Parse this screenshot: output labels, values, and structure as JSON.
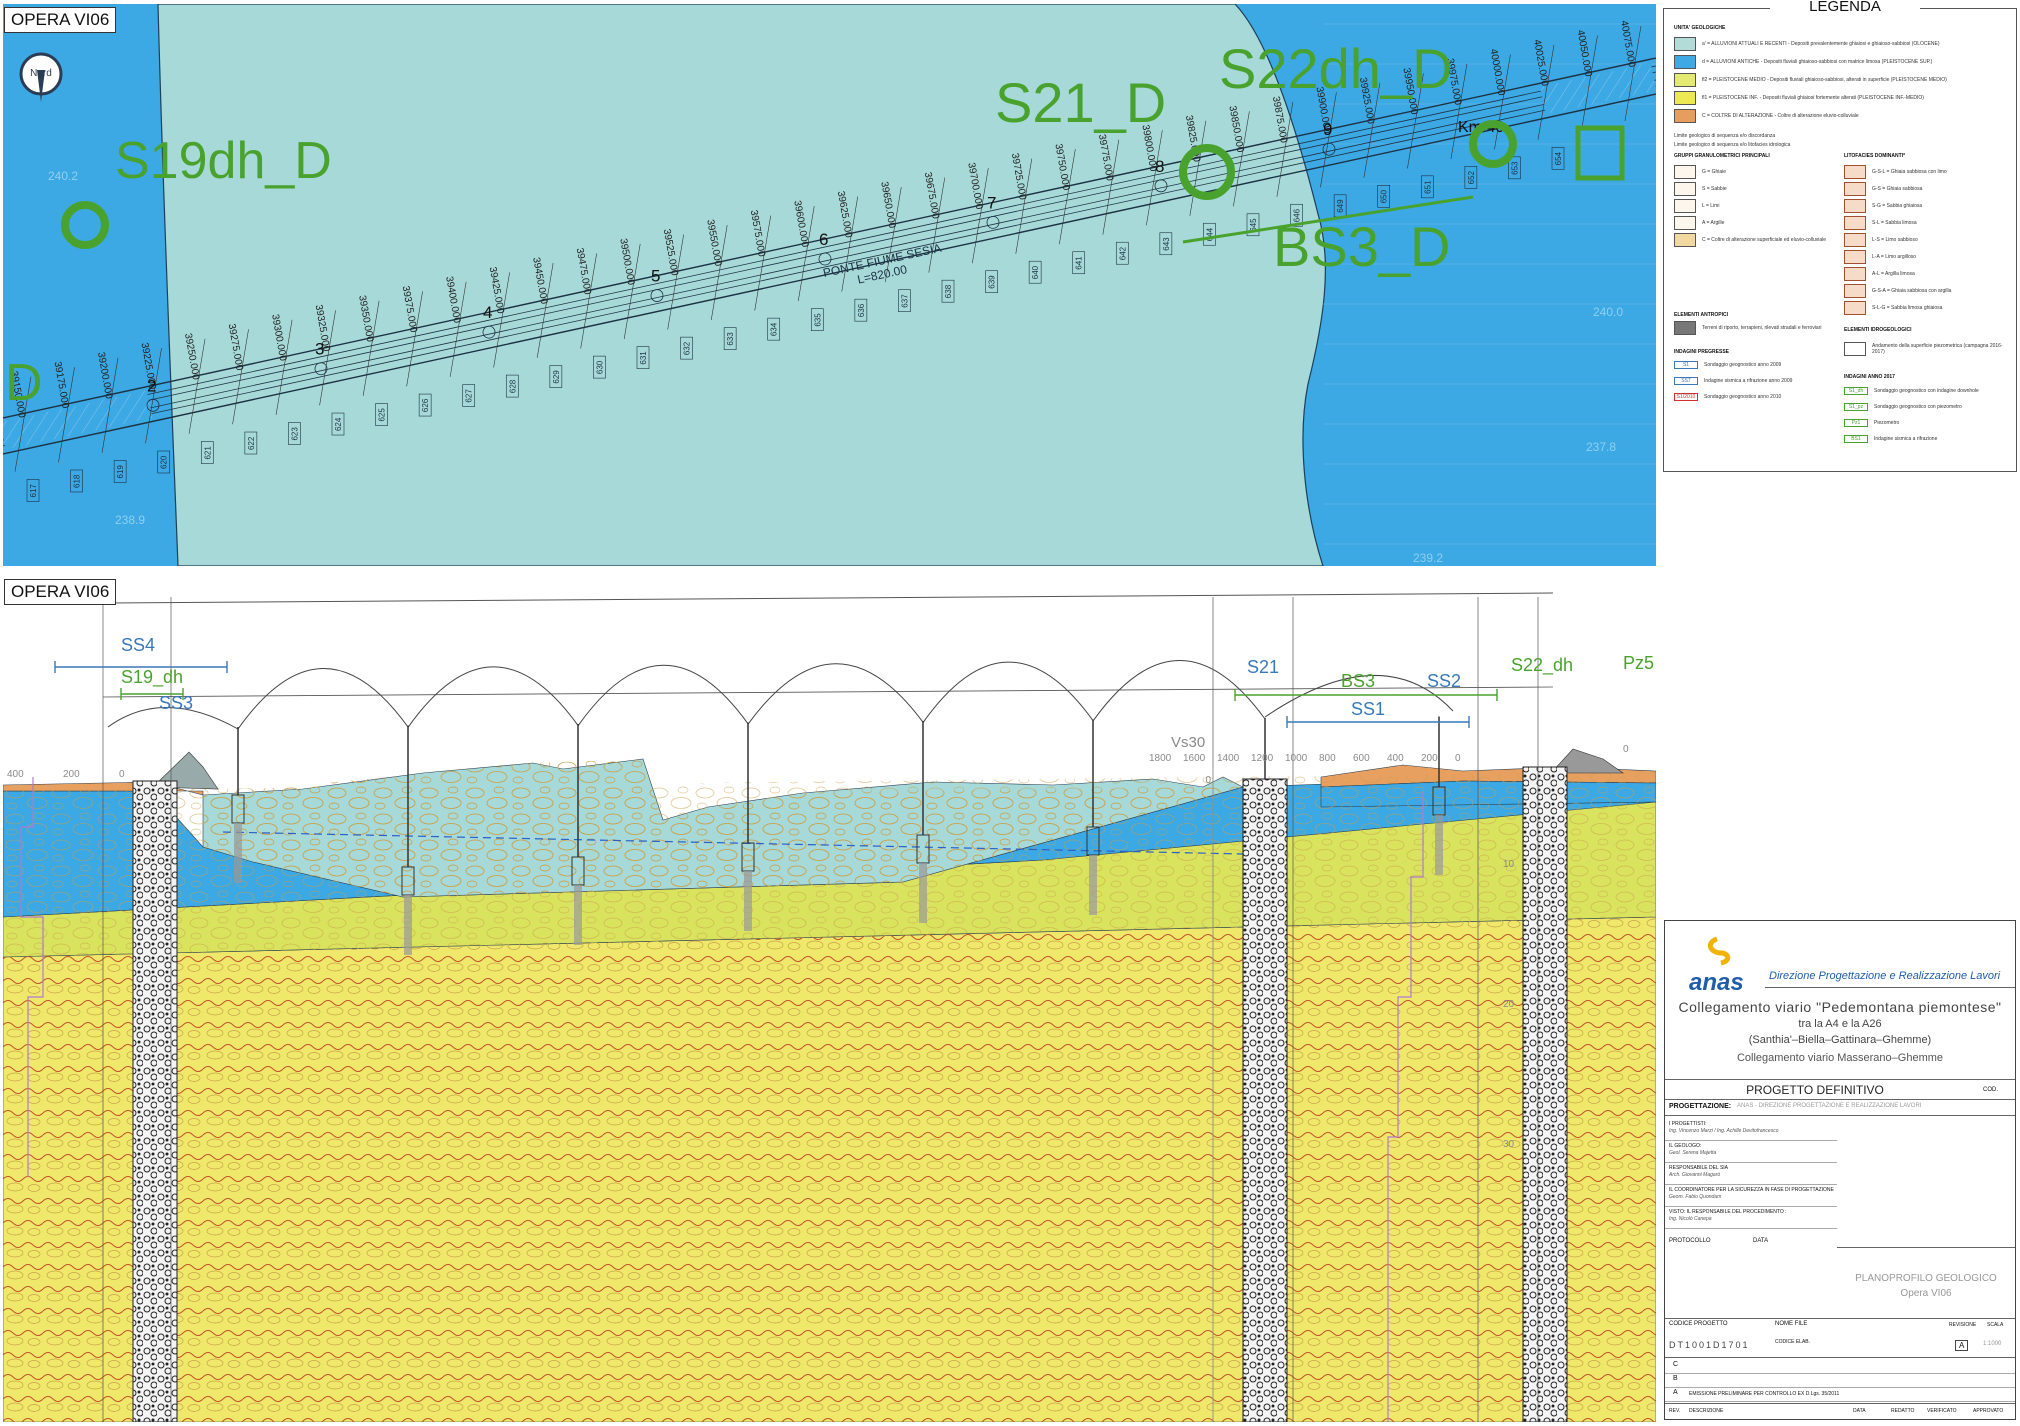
{
  "panels": {
    "plan_label": "OPERA VI06",
    "profile_label": "OPERA VI06"
  },
  "plan": {
    "north_label": "Nord",
    "boreholes": [
      {
        "id": "S19dh_D"
      },
      {
        "id": "S21_D"
      },
      {
        "id": "S22dh_D"
      },
      {
        "id": "BS3_D"
      },
      {
        "id": "D"
      }
    ],
    "bridge_name": "PONTE FIUME SESIA",
    "bridge_length": "L=820.00",
    "km_label": "Km 40",
    "pier_numbers": [
      "2",
      "3",
      "4",
      "5",
      "6",
      "7",
      "8",
      "9"
    ],
    "chainages": [
      "39150.000",
      "39175.000",
      "39200.000",
      "39225.000",
      "39250.000",
      "39275.000",
      "39300.000",
      "39325.000",
      "39350.000",
      "39375.000",
      "39400.000",
      "39425.000",
      "39450.000",
      "39475.000",
      "39500.000",
      "39525.000",
      "39550.000",
      "39575.000",
      "39600.000",
      "39625.000",
      "39650.000",
      "39675.000",
      "39700.000",
      "39725.000",
      "39750.000",
      "39775.000",
      "39800.000",
      "39825.000",
      "39850.000",
      "39875.000",
      "39900.000",
      "39925.000",
      "39950.000",
      "39975.000",
      "40000.000",
      "40025.000",
      "40050.000",
      "40075.000"
    ],
    "sections": [
      "617",
      "618",
      "619",
      "620",
      "621",
      "622",
      "623",
      "624",
      "625",
      "626",
      "627",
      "628",
      "629",
      "630",
      "631",
      "632",
      "633",
      "634",
      "635",
      "636",
      "637",
      "638",
      "639",
      "640",
      "641",
      "642",
      "643",
      "644",
      "645",
      "646",
      "649",
      "650",
      "651",
      "652",
      "653",
      "654"
    ],
    "elevations": [
      "240.2",
      "238.9",
      "240.0",
      "237.8",
      "239.2"
    ]
  },
  "profile": {
    "labels": [
      {
        "text": "SS4",
        "color": "#3a78b8"
      },
      {
        "text": "S19_dh",
        "color": "#4aa22e"
      },
      {
        "text": "SS3",
        "color": "#3a78b8"
      },
      {
        "text": "S21",
        "color": "#3a78b8"
      },
      {
        "text": "BS3",
        "color": "#4aa22e"
      },
      {
        "text": "SS2",
        "color": "#3a78b8"
      },
      {
        "text": "SS1",
        "color": "#3a78b8"
      },
      {
        "text": "S22_dh",
        "color": "#4aa22e"
      },
      {
        "text": "Pz5",
        "color": "#4aa22e"
      }
    ],
    "vs30_label": "Vs30",
    "vs30_ticks": [
      "1800",
      "1600",
      "1400",
      "1200",
      "1000",
      "800",
      "600",
      "400",
      "200",
      "0"
    ],
    "left_ticks": [
      "400",
      "200",
      "0"
    ],
    "right_tick": "0",
    "depth_label": "0",
    "aside_numbers": [
      "10",
      "20",
      "30"
    ]
  },
  "legend": {
    "title": "LEGENDA",
    "sections": {
      "units": "UNITA' GEOLOGICHE",
      "groups": "GRUPPI GRANULOMETRICI PRINCIPALI",
      "lithofacies": "LITOFACIES DOMINANTI*",
      "anthropic": "ELEMENTI ANTROPICI",
      "prior": "INDAGINI PREGRESSE",
      "hydro": "ELEMENTI IDROGEOLOGICI",
      "survey2017": "INDAGINI ANNO 2017"
    },
    "unit_rows": [
      {
        "color": "#b3dcd8",
        "text": "a' = ALLUVIONI ATTUALI E RECENTI - Depositi prevalentemente ghiaiosi e ghiaioso-sabbiosi (OLOCENE)"
      },
      {
        "color": "#3fa9e6",
        "text": "d = ALLUVIONI ANTICHE - Depositi fluviali ghiaioso-sabbiosi con matrice limosa (PLEISTOCENE SUP.)"
      },
      {
        "color": "#e3ea6f",
        "text": "fl2 = PLEISTOCENE MEDIO - Depositi fluviali ghiaioso-sabbiosi, alterati in superficie (PLEISTOCENE MEDIO)"
      },
      {
        "color": "#ece955",
        "text": "fl1 = PLEISTOCENE INF. - Depositi fluviali ghiaiosi fortemente alterati (PLEISTOCENE INF.-MEDIO)"
      },
      {
        "color": "#e79d5d",
        "text": "C = COLTRE DI ALTERAZIONE - Coltre di alterazione eluvio-colluviale"
      }
    ],
    "line_rows": [
      {
        "text": "Limite geologico di sequenza e/o discordanza"
      },
      {
        "text": "Limite geologico di sequenza e/o litofacies idrologica"
      }
    ],
    "group_rows": [
      "G = Ghiaie",
      "S = Sabbie",
      "L = Limi",
      "A = Argille",
      "C = Coltre di alterazione superficiale ed eluvio-colluviale"
    ],
    "litho_rows": [
      "G-S-L = Ghiaia sabbiosa con limo",
      "G-S = Ghiaia sabbiosa",
      "S-G = Sabbia ghiaiosa",
      "S-L = Sabbia limosa",
      "L-S = Limo sabbioso",
      "L-A = Limo argilloso",
      "A-L = Argilla limosa",
      "G-S-A = Ghiaia sabbiosa con argilla",
      "S-L-G = Sabbia limosa ghiaiosa"
    ],
    "anthropic_row": "Terreni di riporto, terrapieni, rilevati stradali e ferroviari",
    "prior_rows": [
      {
        "code": "S1",
        "text": "Sondaggio geognostico anno 2009"
      },
      {
        "code": "SS7",
        "text": "Indagine sismica a rifrazione anno 2009"
      },
      {
        "code": "S1/2010",
        "text": "Sondaggio geognostico anno 2010"
      }
    ],
    "hydro_row": "Andamento della superficie piezometrica (campagna 2016-2017)",
    "survey_rows": [
      {
        "code": "S1_dh",
        "text": "Sondaggio geognostico con indagine downhole"
      },
      {
        "code": "S1_pz",
        "text": "Sondaggio geognostico con piezometro"
      },
      {
        "code": "Pz1",
        "text": "Piezometro"
      },
      {
        "code": "BS1",
        "text": "Indagine sismica a rifrazione"
      }
    ]
  },
  "titleblock": {
    "logo_text": "anas",
    "direction": "Direzione Progettazione e Realizzazione Lavori",
    "project_lines": [
      "Collegamento viario \"Pedemontana piemontese\"",
      "tra la A4 e la A26",
      "(Santhia'–Biella–Gattinara–Ghemme)",
      "Collegamento viario Masserano–Ghemme"
    ],
    "phase": "PROGETTO DEFINITIVO",
    "cod_label": "COD.",
    "progettazione_label": "PROGETTAZIONE:",
    "progettazione_value": "ANAS - DIREZIONE PROGETTAZIONE E REALIZZAZIONE LAVORI",
    "staff": [
      {
        "role": "I PROGETTISTI:",
        "name": "Ing. Vincenzo Marzi / Ing. Achille Devitofrancesco"
      },
      {
        "role": "IL GEOLOGO:",
        "name": "Geol. Serena Majetta"
      },
      {
        "role": "RESPONSABILE DEL SIA",
        "name": "Arch. Giovanni Magarò"
      },
      {
        "role": "IL COORDINATORE PER LA SICUREZZA IN FASE DI PROGETTAZIONE",
        "name": "Geom. Fabio Quondam"
      },
      {
        "role": "VISTO: IL RESPONSABILE DEL PROCEDIMENTO :",
        "name": "Ing. Nicolò Canepa"
      }
    ],
    "protocollo_label": "PROTOCOLLO",
    "data_label": "DATA",
    "drawing_title": "PLANOPROFILO GEOLOGICO",
    "drawing_subtitle": "Opera VI06",
    "codice_progetto_label": "CODICE PROGETTO",
    "nome_file_label": "NOME FILE",
    "revisione_label": "REVISIONE",
    "scala_label": "SCALA",
    "codice_progetto_value": "DT1001D1701",
    "codice_elab_label": "CODICE ELAB.",
    "revisione_value": "A",
    "scala_value": "1:1000",
    "revisions": [
      "C",
      "B",
      "A"
    ],
    "rev_a_text": "EMISSIONE PRELIMINARE PER CONTROLLO EX D.Lgs. 35/2011",
    "footer": [
      "REV.",
      "DESCRIZIONE",
      "DATA",
      "REDATTO",
      "VERIFICATO",
      "APPROVATO"
    ]
  },
  "colors": {
    "alluvium_recent": "#a7d9d8",
    "alluvium_old": "#3ca8e4",
    "pleistocene_medio": "#d9e35e",
    "pleistocene_inf": "#efe86b",
    "coltre": "#e7a05f",
    "borehole_green": "#4aa22e",
    "survey_blue": "#3a78b8"
  }
}
